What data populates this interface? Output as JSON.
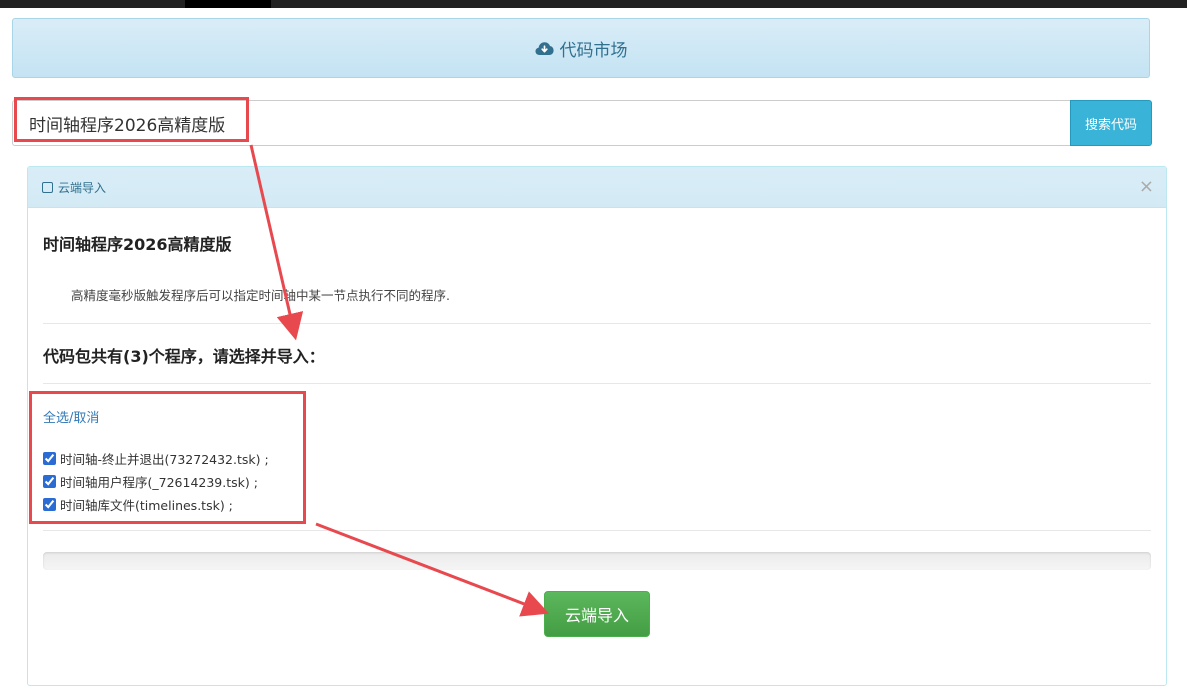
{
  "market": {
    "title": "代码市场",
    "icon": "cloud-download-icon"
  },
  "search": {
    "value": "时间轴程序2026高精度版",
    "button_label": "搜索代码"
  },
  "panel": {
    "heading": "云端导入",
    "close_glyph": "×",
    "package_title": "时间轴程序2026高精度版",
    "description": "高精度毫秒版触发程序后可以指定时间轴中某一节点执行不同的程序.",
    "choose_prompt": "代码包共有(3)个程序，请选择并导入：",
    "select_all_label": "全选/取消",
    "files": [
      {
        "label": "时间轴-终止并退出(73272432.tsk) ;",
        "checked": true
      },
      {
        "label": "时间轴用户程序(_72614239.tsk) ;",
        "checked": true
      },
      {
        "label": "时间轴库文件(timelines.tsk) ;",
        "checked": true
      }
    ],
    "progress": 0,
    "import_button_label": "云端导入"
  },
  "colors": {
    "header_bg": "#d9edf7",
    "info_text": "#31708f",
    "search_button": "#39b3d7",
    "import_button": "#5cb85c",
    "annotation": "#e8494f",
    "link": "#337ab7"
  }
}
